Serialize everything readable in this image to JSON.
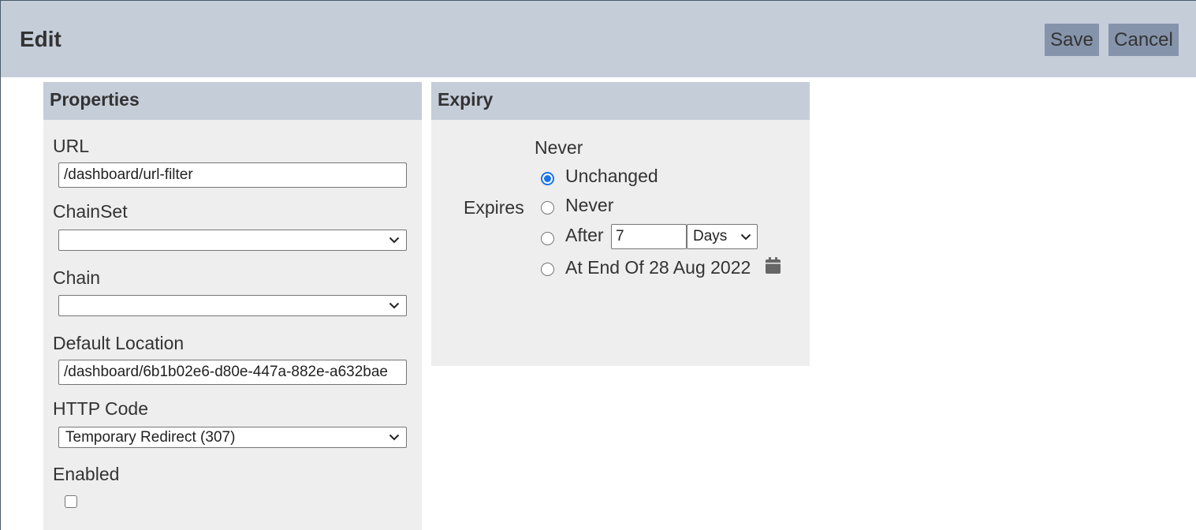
{
  "header": {
    "title": "Edit",
    "save_label": "Save",
    "cancel_label": "Cancel"
  },
  "properties": {
    "title": "Properties",
    "url": {
      "label": "URL",
      "value": "/dashboard/url-filter"
    },
    "chainset": {
      "label": "ChainSet",
      "value": ""
    },
    "chain": {
      "label": "Chain",
      "value": ""
    },
    "default_location": {
      "label": "Default Location",
      "value": "/dashboard/6b1b02e6-d80e-447a-882e-a632bae"
    },
    "http_code": {
      "label": "HTTP Code",
      "value": "Temporary Redirect (307)"
    },
    "enabled": {
      "label": "Enabled",
      "checked": false
    }
  },
  "expiry": {
    "title": "Expiry",
    "current_value": "Never",
    "expires_label": "Expires",
    "options": {
      "unchanged": "Unchanged",
      "never": "Never",
      "after": "After",
      "at_end_of": "At End Of 28 Aug 2022"
    },
    "selected": "unchanged",
    "after_amount": "7",
    "after_unit": "Days"
  },
  "icons": {
    "dropdown": "chevron-down-icon",
    "calendar": "calendar-icon"
  },
  "colors": {
    "header_bg": "#c5cdd9",
    "button_bg": "#8594ab",
    "panel_bg": "#eeeeee",
    "radio_accent": "#1a73e8"
  }
}
